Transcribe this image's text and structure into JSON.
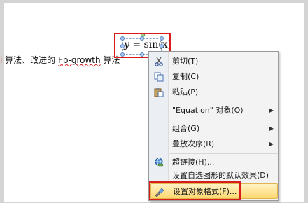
{
  "document": {
    "text_prefix": "i",
    "text_main": " 算法、改进的 ",
    "text_underlined": "Fp-growth",
    "text_suffix": " 算法"
  },
  "equation": {
    "lhs": "y",
    "rest": " = sin(x)"
  },
  "context_menu": {
    "items": [
      {
        "label": "剪切(T)",
        "icon": "scissors-icon"
      },
      {
        "label": "复制(C)",
        "icon": "copy-icon"
      },
      {
        "label": "粘贴(P)",
        "icon": "paste-icon"
      },
      {
        "label": "\"Equation\" 对象(O)",
        "icon": "",
        "submenu": true
      },
      {
        "label": "组合(G)",
        "icon": "",
        "submenu": true
      },
      {
        "label": "叠放次序(R)",
        "icon": "",
        "submenu": true
      },
      {
        "label": "超链接(H)...",
        "icon": "hyperlink-icon"
      },
      {
        "label": "设置自选图形的默认效果(D)",
        "icon": ""
      },
      {
        "label": "设置对象格式(F)...",
        "icon": "format-object-icon"
      }
    ]
  },
  "colors": {
    "highlight_red": "#d81c1c",
    "hover_gradient_top": "#fff2c4",
    "hover_gradient_bottom": "#ffd870"
  }
}
